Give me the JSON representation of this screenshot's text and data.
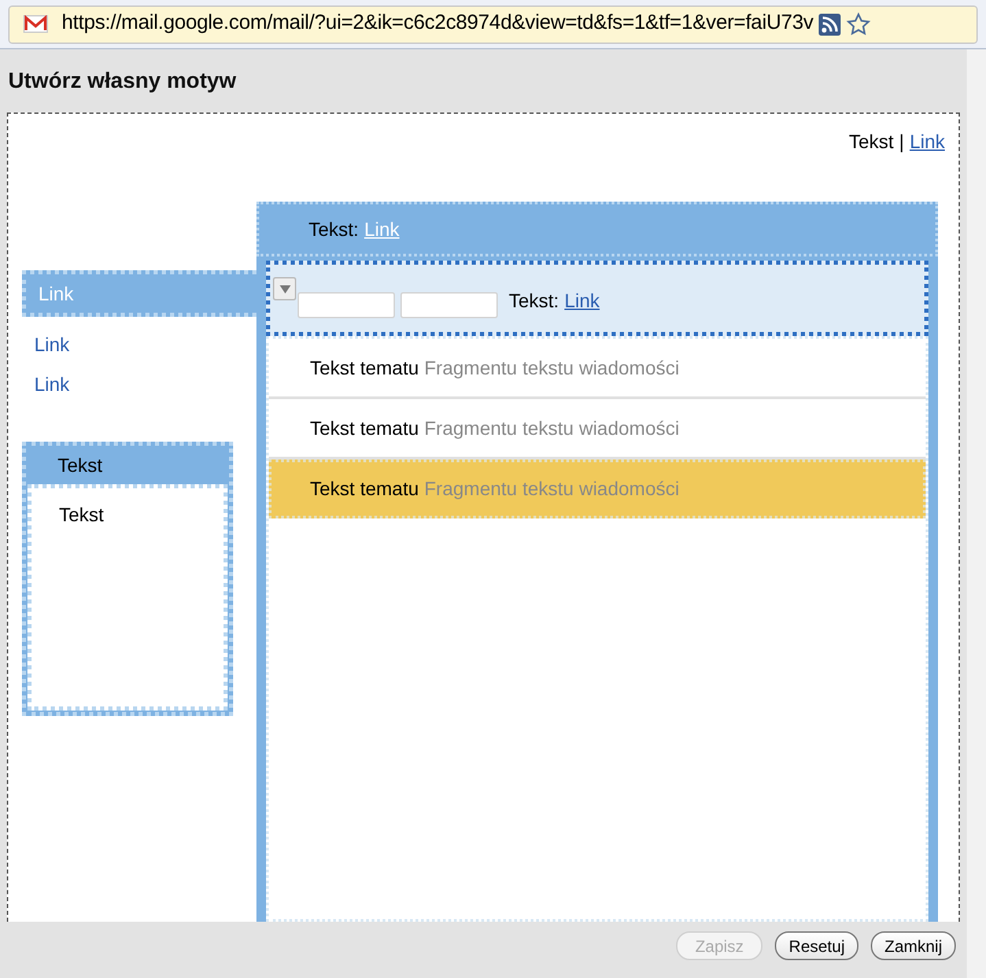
{
  "address_bar": {
    "url": "https://mail.google.com/mail/?ui=2&ik=c6c2c8974d&view=td&fs=1&tf=1&ver=faiU73v"
  },
  "dialog": {
    "title": "Utwórz własny motyw"
  },
  "preview": {
    "top_links": {
      "text": "Tekst",
      "separator": "|",
      "link": "Link"
    },
    "nav_items": [
      {
        "label": "Link",
        "selected": true
      },
      {
        "label": "Link",
        "selected": false
      },
      {
        "label": "Link",
        "selected": false
      }
    ],
    "side_box": {
      "header": "Tekst",
      "body": "Tekst"
    },
    "panel_header": {
      "label": "Tekst:",
      "link": "Link"
    },
    "toolbar": {
      "label": "Tekst:",
      "link": "Link"
    },
    "messages": [
      {
        "subject": "Tekst tematu",
        "snippet": "Fragmentu tekstu wiadomości",
        "selected": false
      },
      {
        "subject": "Tekst tematu",
        "snippet": "Fragmentu tekstu wiadomości",
        "selected": false
      },
      {
        "subject": "Tekst tematu",
        "snippet": "Fragmentu tekstu wiadomości",
        "selected": true
      }
    ]
  },
  "buttons": [
    {
      "label": "Zapisz",
      "disabled": true
    },
    {
      "label": "Resetuj",
      "disabled": false
    },
    {
      "label": "Zamknij",
      "disabled": false
    }
  ]
}
